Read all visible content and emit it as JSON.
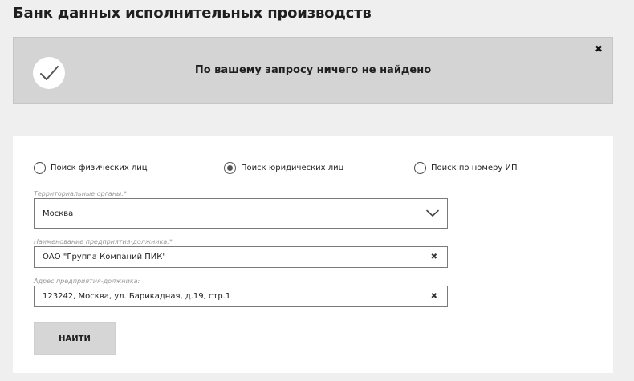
{
  "page": {
    "title": "Банк данных исполнительных производств"
  },
  "banner": {
    "message": "По вашему запросу ничего не найдено",
    "close_symbol": "✖",
    "icon": "checkmark-icon"
  },
  "search_form": {
    "radio_options": [
      {
        "label": "Поиск физических лиц",
        "checked": false
      },
      {
        "label": "Поиск юридических лиц",
        "checked": true
      },
      {
        "label": "Поиск по номеру ИП",
        "checked": false
      }
    ],
    "fields": {
      "territorial_body": {
        "label": "Территориальные органы:*",
        "value": "Москва",
        "icon": "chevron-down-icon"
      },
      "enterprise_name": {
        "label": "Наименование предприятия-должника:*",
        "value": "ОАО \"Группа Компаний ПИК\"",
        "clear_symbol": "✖"
      },
      "enterprise_address": {
        "label": "Адрес предприятия-должника:",
        "value": "123242, Москва, ул. Барикадная, д.19, стр.1",
        "clear_symbol": "✖"
      }
    },
    "submit_label": "НАЙТИ"
  }
}
